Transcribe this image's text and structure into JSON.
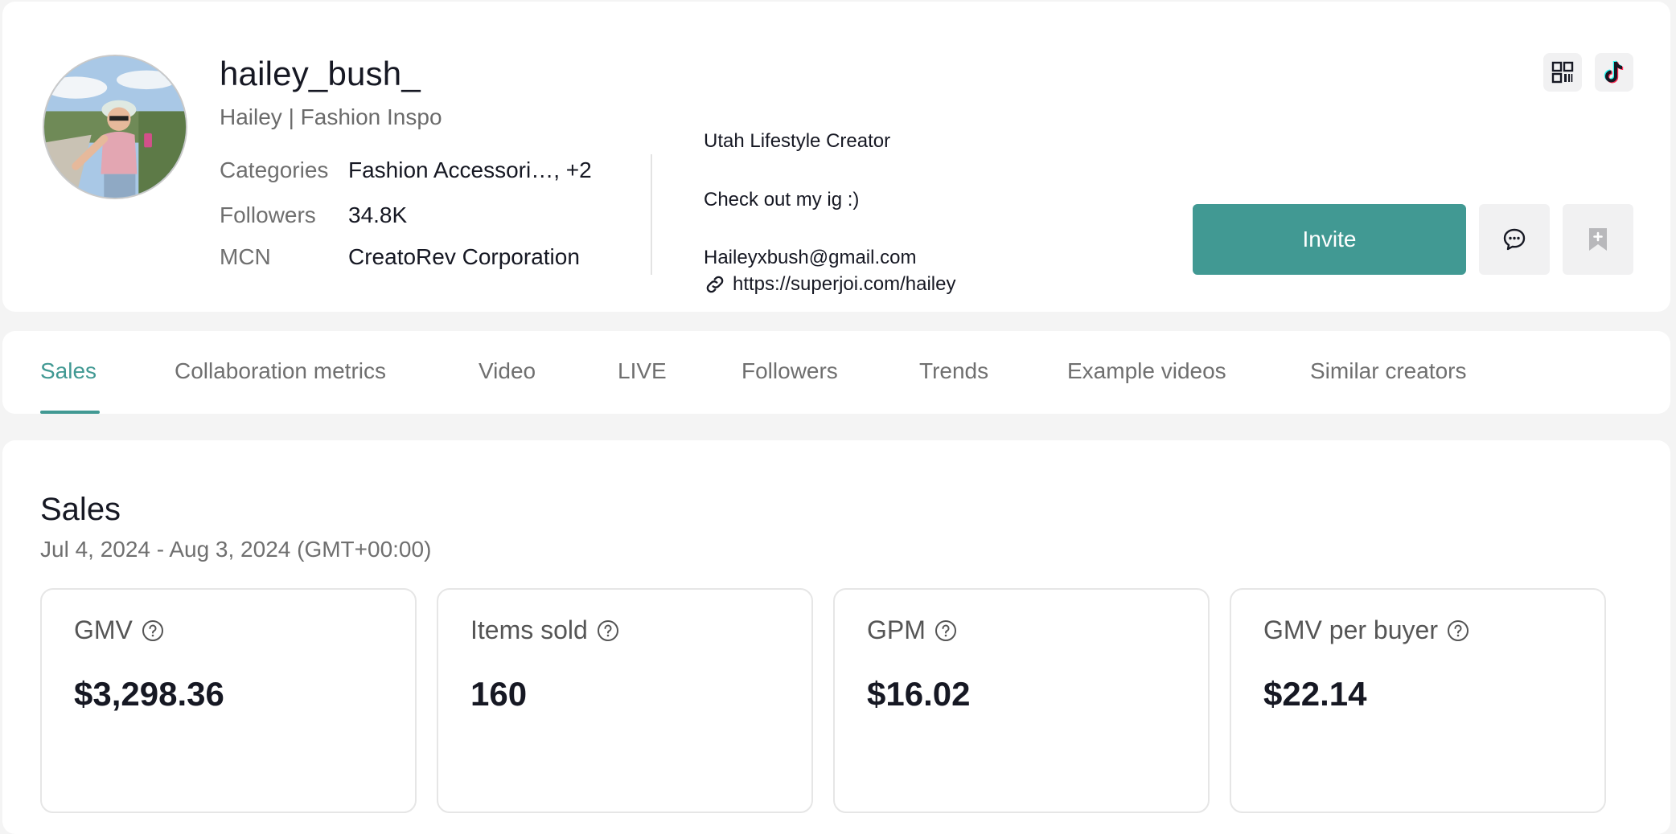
{
  "profile": {
    "username": "hailey_bush_",
    "nickname": "Hailey | Fashion Inspo",
    "categories_label": "Categories",
    "categories_value": "Fashion Accessori…, +2",
    "followers_label": "Followers",
    "followers_value": "34.8K",
    "mcn_label": "MCN",
    "mcn_value": "CreatoRev Corporation",
    "bio_line1": "Utah Lifestyle Creator",
    "bio_line2": "Check out my ig :)",
    "bio_line3": "Haileyxbush@gmail.com",
    "link": "https://superjoi.com/hailey",
    "invite_label": "Invite",
    "icons": [
      "qr-code-icon",
      "tiktok-icon",
      "message-icon",
      "bookmark-add-icon",
      "link-icon"
    ]
  },
  "tabs": [
    {
      "label": "Sales",
      "active": true
    },
    {
      "label": "Collaboration metrics"
    },
    {
      "label": "Video"
    },
    {
      "label": "LIVE"
    },
    {
      "label": "Followers"
    },
    {
      "label": "Trends"
    },
    {
      "label": "Example videos"
    },
    {
      "label": "Similar creators"
    }
  ],
  "sales": {
    "title": "Sales",
    "date_range": "Jul 4, 2024 - Aug 3, 2024 (GMT+00:00)",
    "metrics": [
      {
        "label": "GMV",
        "value": "$3,298.36"
      },
      {
        "label": "Items sold",
        "value": "160"
      },
      {
        "label": "GPM",
        "value": "$16.02"
      },
      {
        "label": "GMV per buyer",
        "value": "$22.14"
      }
    ]
  },
  "colors": {
    "accent": "#419993",
    "background": "#f4f4f4",
    "card": "#ffffff",
    "muted_text": "#6f6f6f"
  }
}
